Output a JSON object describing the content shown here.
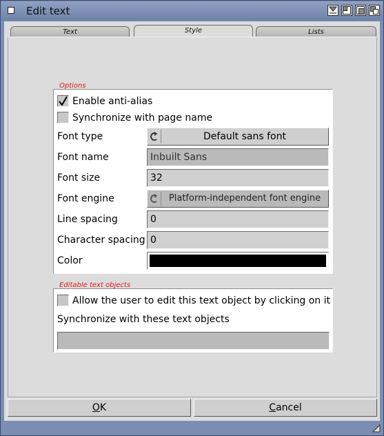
{
  "window": {
    "title": "Edit text"
  },
  "tabs": [
    {
      "label": "Text",
      "active": false
    },
    {
      "label": "Style",
      "active": true
    },
    {
      "label": "Lists",
      "active": false
    }
  ],
  "options": {
    "title": "Options",
    "enable_antialias": {
      "label": "Enable anti-alias",
      "checked": true
    },
    "sync_page_name": {
      "label": "Synchronize with page name",
      "checked": false
    },
    "font_type": {
      "label": "Font type",
      "value": "Default sans font"
    },
    "font_name": {
      "label": "Font name",
      "value": "Inbuilt Sans"
    },
    "font_size": {
      "label": "Font size",
      "value": "32"
    },
    "font_engine": {
      "label": "Font engine",
      "value": "Platform-independent font engine"
    },
    "line_spacing": {
      "label": "Line spacing",
      "value": "0"
    },
    "char_spacing": {
      "label": "Character spacing",
      "value": "0"
    },
    "color": {
      "label": "Color",
      "value": "#000000"
    }
  },
  "editable": {
    "title": "Editable text objects",
    "allow_edit": {
      "label": "Allow the user to edit this text object by clicking on it",
      "checked": false
    },
    "sync_label": "Synchronize with these text objects"
  },
  "buttons": {
    "ok_hotkey": "O",
    "ok_rest": "K",
    "cancel_hotkey": "C",
    "cancel_rest": "ancel"
  }
}
